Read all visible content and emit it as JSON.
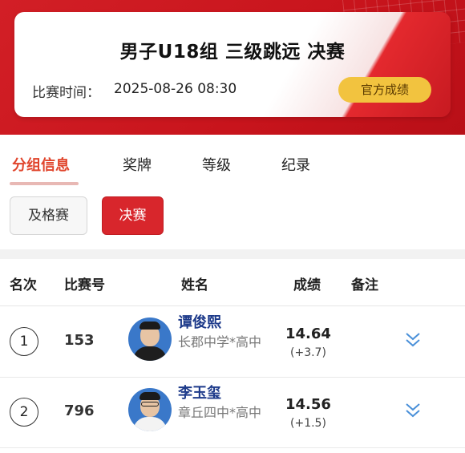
{
  "header": {
    "title": "男子U18组 三级跳远 决赛",
    "time_label": "比赛时间：",
    "time_value": "2025-08-26  08:30",
    "official_button": "官方成绩"
  },
  "tabs": [
    {
      "label": "分组信息",
      "active": true
    },
    {
      "label": "奖牌",
      "active": false
    },
    {
      "label": "等级",
      "active": false
    },
    {
      "label": "纪录",
      "active": false
    }
  ],
  "rounds": [
    {
      "label": "及格赛",
      "active": false
    },
    {
      "label": "决赛",
      "active": true
    }
  ],
  "table": {
    "headers": {
      "rank": "名次",
      "bib": "比赛号",
      "name": "姓名",
      "result": "成绩",
      "note": "备注"
    },
    "rows": [
      {
        "rank": "1",
        "bib": "153",
        "name": "谭俊熙",
        "school": "长郡中学*高中",
        "mark": "14.64",
        "wind": "(+3.7)"
      },
      {
        "rank": "2",
        "bib": "796",
        "name": "李玉玺",
        "school": "章丘四中*高中",
        "mark": "14.56",
        "wind": "(+1.5)"
      }
    ]
  },
  "colors": {
    "brand_red": "#d21f26",
    "active_tab": "#e0442b",
    "official_button": "#f2c33f",
    "name_blue": "#1d3a8a",
    "expand_icon": "#4a90d9"
  },
  "icons": {
    "expand": "double-chevron-down-icon"
  }
}
